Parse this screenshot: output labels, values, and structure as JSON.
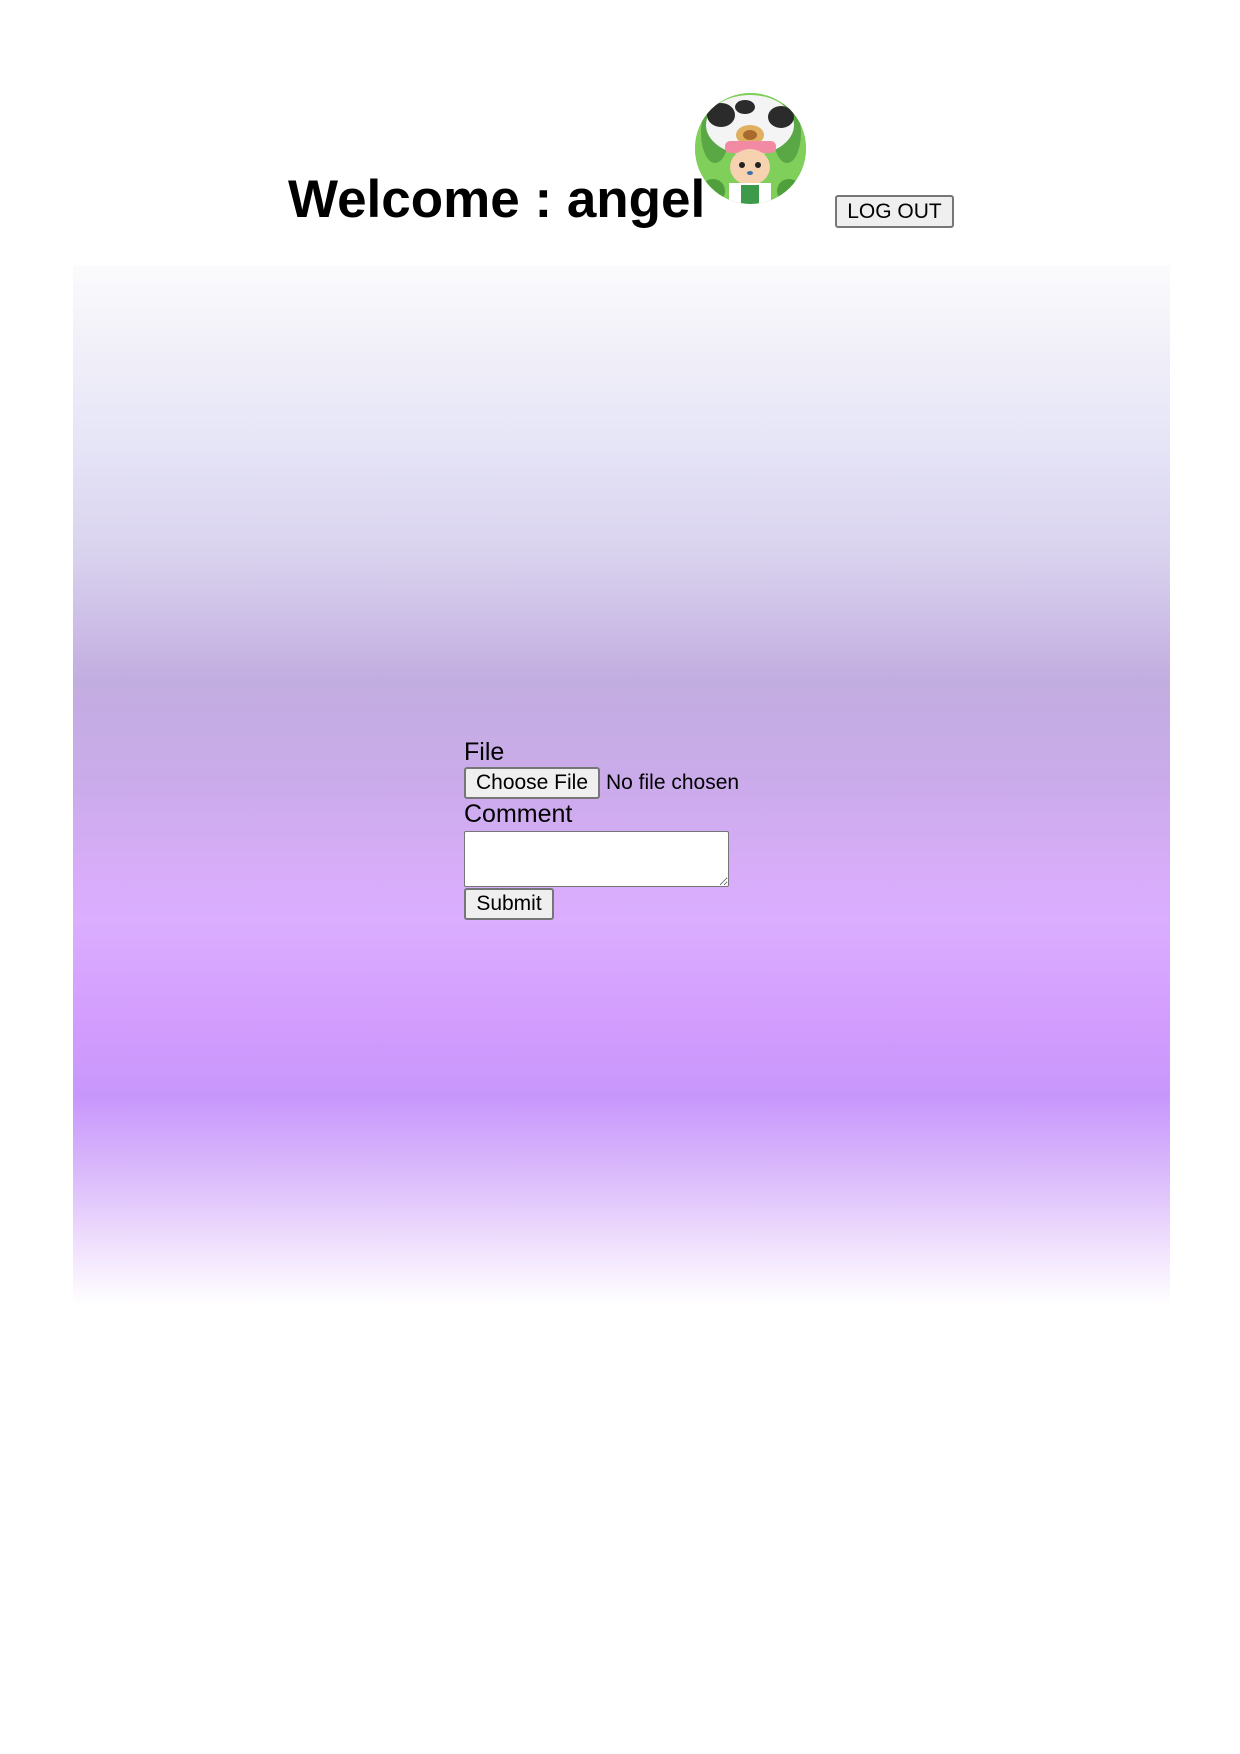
{
  "header": {
    "welcome_text": "Welcome : angel",
    "logout_label": "LOG OUT"
  },
  "upload_form": {
    "file_label": "File",
    "choose_file_label": "Choose File",
    "file_status": "No file chosen",
    "comment_label": "Comment",
    "comment_value": "",
    "submit_label": "Submit"
  },
  "colors": {
    "panel_top": "#fbfbfd",
    "panel_mid": "#c2ade0",
    "panel_light_violet": "#dbaeff",
    "panel_deep_violet": "#c897fc",
    "button_bg": "#efefef",
    "button_border": "#767676",
    "avatar_bg": "#7fcf5a"
  }
}
